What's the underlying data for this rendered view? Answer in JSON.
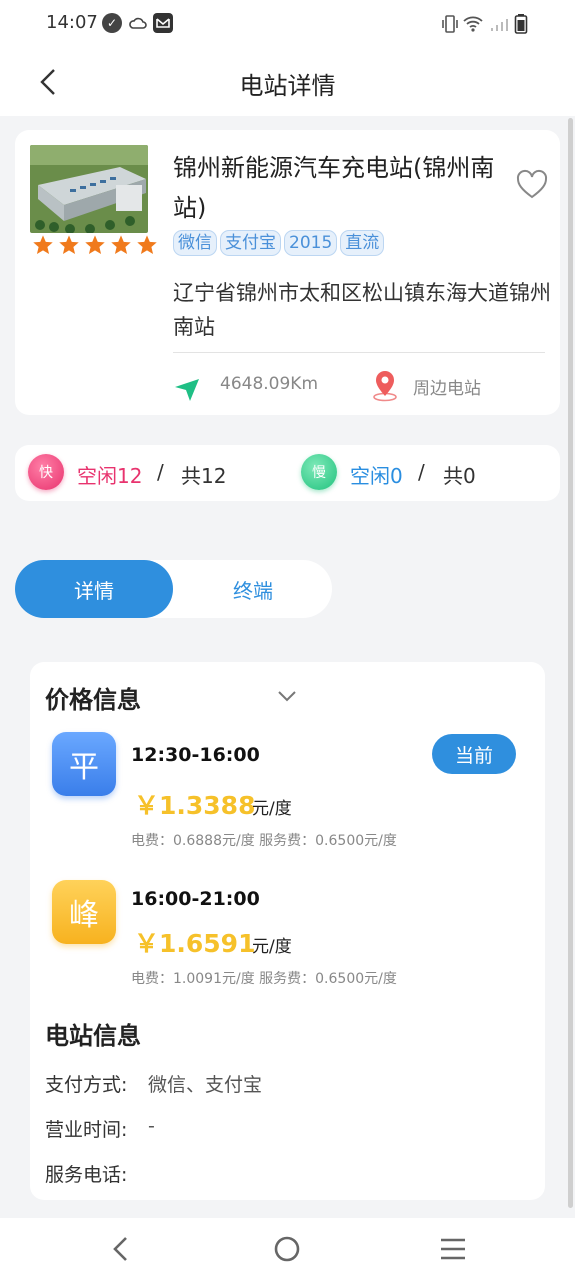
{
  "status_bar": {
    "time": "14:07"
  },
  "header": {
    "title": "电站详情"
  },
  "station": {
    "name": "锦州新能源汽车充电站(锦州南站)",
    "rating": 5,
    "tags": [
      "微信",
      "支付宝",
      "2015",
      "直流"
    ],
    "address": "辽宁省锦州市太和区松山镇东海大道锦州南站",
    "distance": "4648.09Km",
    "nearby_label": "周边电站"
  },
  "summary": {
    "fast_badge": "快",
    "fast_idle": "空闲12",
    "fast_sep": "/",
    "fast_total": "共12",
    "slow_badge": "慢",
    "slow_idle": "空闲0",
    "slow_sep": "/",
    "slow_total": "共0"
  },
  "tabs": {
    "detail": "详情",
    "terminal": "终端"
  },
  "price_info": {
    "title": "价格信息",
    "current_label": "当前",
    "periods": [
      {
        "icon_text": "平",
        "time": "12:30-16:00",
        "price": "￥1.3388",
        "unit": "元/度",
        "detail": "电费：0.6888元/度  服务费：0.6500元/度"
      },
      {
        "icon_text": "峰",
        "time": "16:00-21:00",
        "price": "￥1.6591",
        "unit": "元/度",
        "detail": "电费：1.0091元/度  服务费：0.6500元/度"
      }
    ]
  },
  "station_info": {
    "title": "电站信息",
    "payment_label": "支付方式:",
    "payment_value": "微信、支付宝",
    "hours_label": "营业时间:",
    "hours_value": "-",
    "phone_label": "服务电话:",
    "phone_value": ""
  },
  "colors": {
    "accent": "#2f8fde",
    "fast": "#e8336e",
    "price": "#f6c12a"
  }
}
